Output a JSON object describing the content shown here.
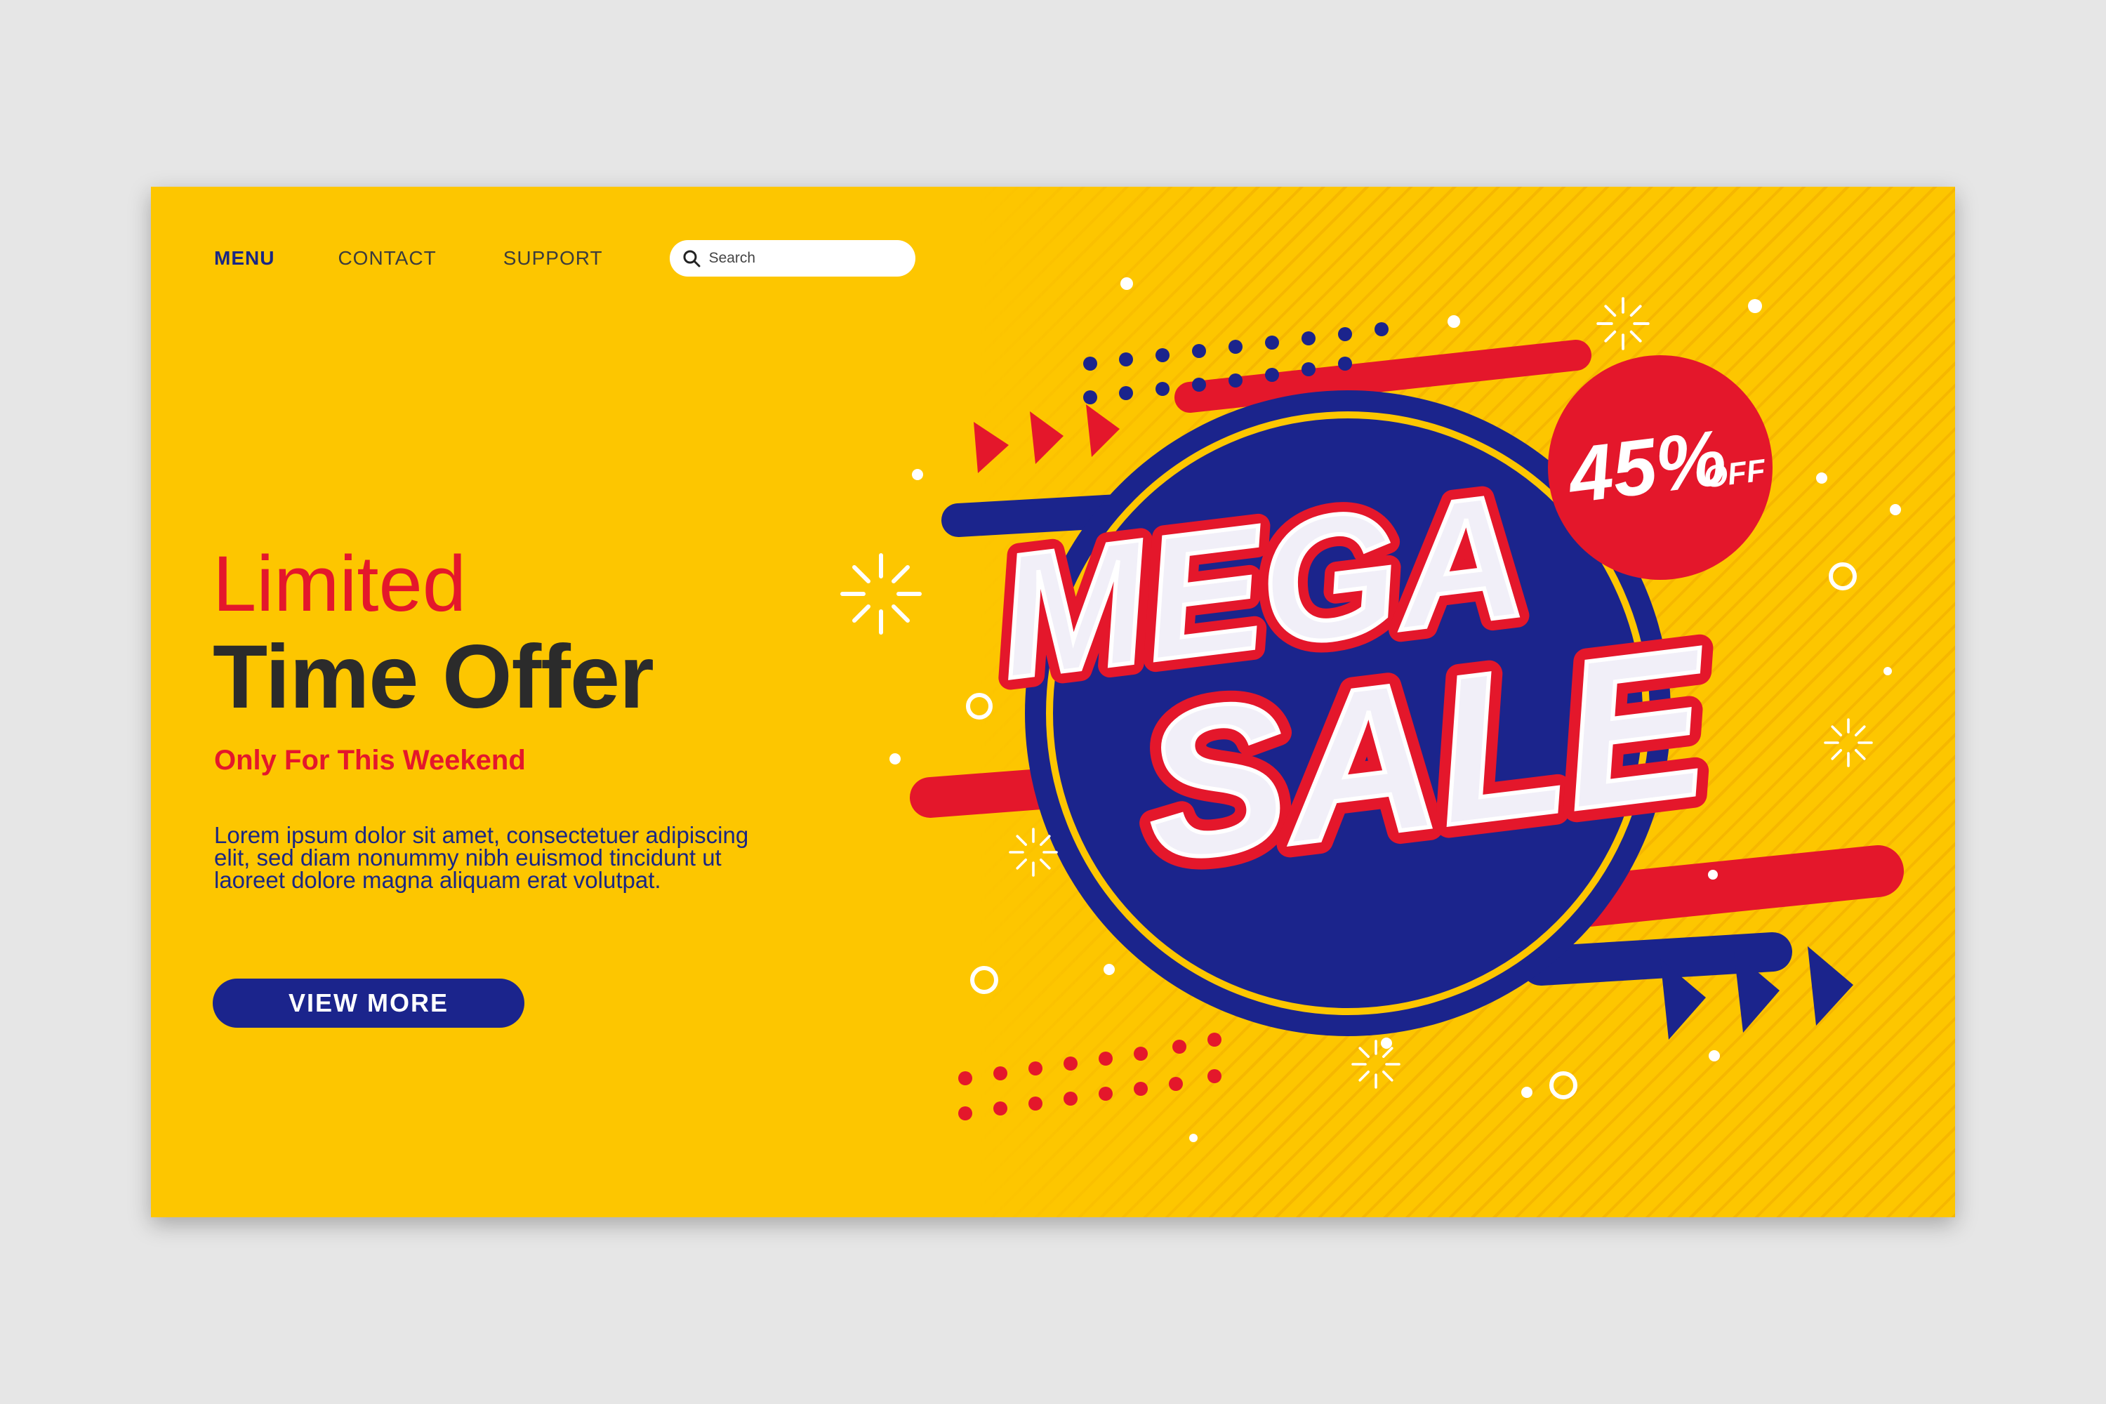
{
  "nav": {
    "menu": "MENU",
    "contact": "CONTACT",
    "support": "SUPPORT",
    "search_placeholder": "Search"
  },
  "hero": {
    "limited": "Limited",
    "headline": "Time Offer",
    "sub": "Only For This Weekend",
    "body": "Lorem ipsum dolor sit amet, consectetuer adipiscing elit, sed diam nonummy nibh euismod tincidunt ut laoreet dolore magna aliquam erat volutpat.",
    "cta": "VIEW MORE"
  },
  "promo": {
    "title_line1": "MEGA",
    "title_line2": "SALE",
    "discount": "45%",
    "discount_suffix": "OFF"
  },
  "colors": {
    "background": "#fdc600",
    "navy": "#1b248c",
    "red": "#e4172b",
    "white": "#ffffff"
  },
  "icons": [
    "search-icon",
    "arrow-icon",
    "sparkle-icon"
  ]
}
